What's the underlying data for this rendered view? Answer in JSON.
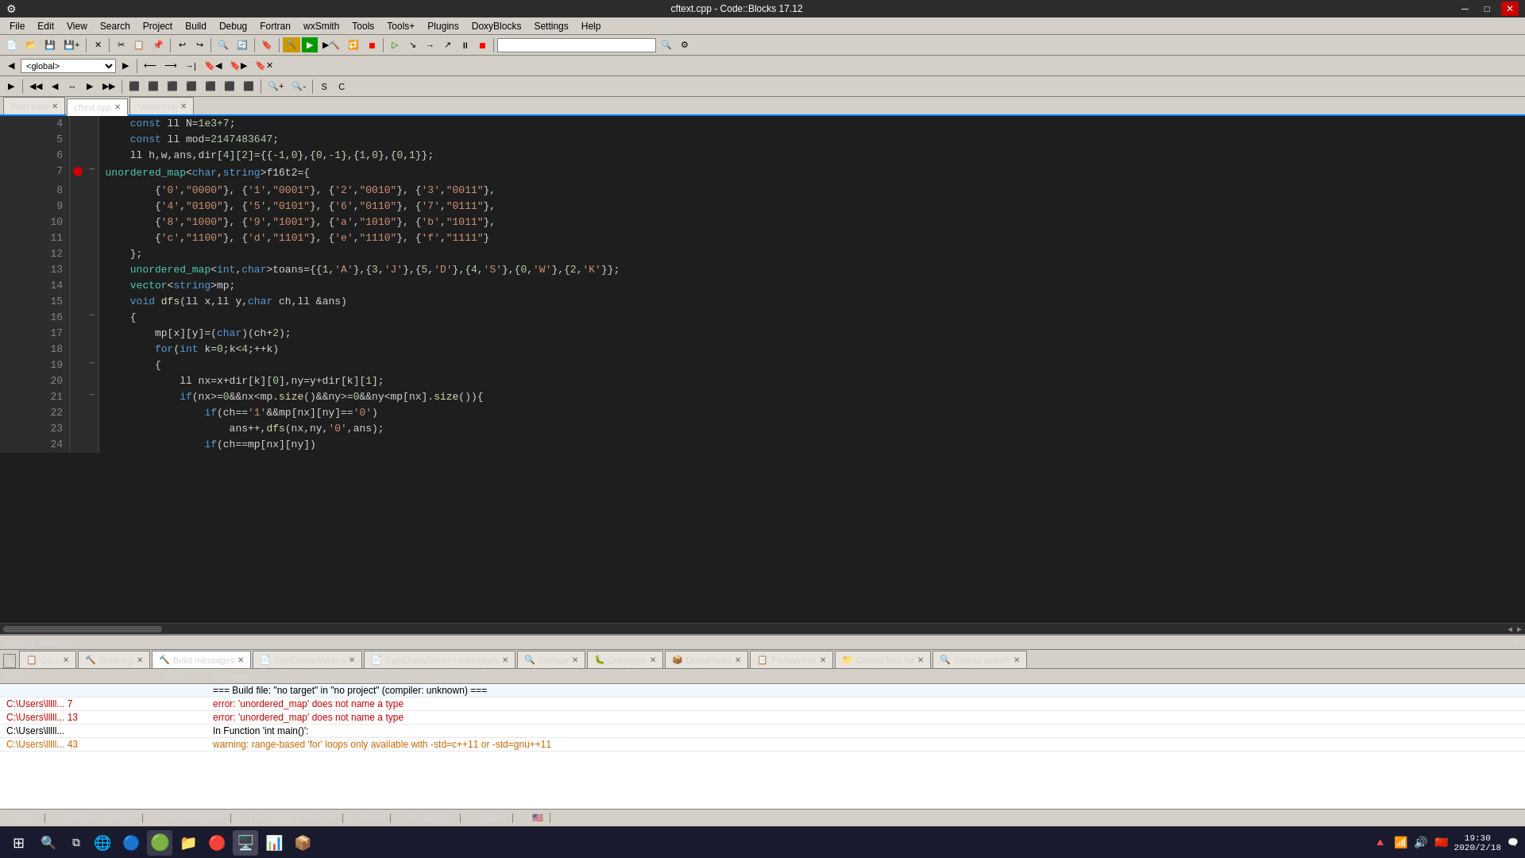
{
  "titlebar": {
    "title": "cftext.cpp - Code::Blocks 17.12",
    "min": "─",
    "max": "□",
    "close": "✕"
  },
  "menubar": {
    "items": [
      "File",
      "Edit",
      "View",
      "Search",
      "Project",
      "Build",
      "Debug",
      "Fortran",
      "wxSmith",
      "Tools",
      "Tools+",
      "Plugins",
      "DoxyBlocks",
      "Settings",
      "Help"
    ]
  },
  "global_scope": "<global>",
  "tabs": [
    {
      "label": "Start here",
      "active": false,
      "closeable": true
    },
    {
      "label": "cftext.cpp",
      "active": true,
      "closeable": true
    },
    {
      "label": "*swpu.cpp",
      "active": false,
      "closeable": true
    }
  ],
  "code_lines": [
    {
      "num": 4,
      "bp": "",
      "fold": "",
      "content_html": "    <span class='kw'>const</span> ll N=<span class='num'>1e3+7</span>;"
    },
    {
      "num": 5,
      "bp": "",
      "fold": "",
      "content_html": "    <span class='kw'>const</span> ll mod=<span class='num'>2147483647</span>;"
    },
    {
      "num": 6,
      "bp": "",
      "fold": "",
      "content_html": "    ll h,w,ans,dir[<span class='num'>4</span>][<span class='num'>2</span>]={{<span class='num'>-1</span>,<span class='num'>0</span>},{<span class='num'>0</span>,<span class='num'>-1</span>},{<span class='num'>1</span>,<span class='num'>0</span>},{<span class='num'>0</span>,<span class='num'>1</span>}};"
    },
    {
      "num": 7,
      "bp": "●",
      "fold": "□",
      "content_html": "<span class='cyan-text'>unordered_map</span>&lt;<span class='kw'>char</span>,<span class='kw'>string</span>&gt;f16t2={"
    },
    {
      "num": 8,
      "bp": "",
      "fold": "",
      "content_html": "        {<span class='str'>'0'</span>,<span class='str'>\"0000\"</span>}, {<span class='str'>'1'</span>,<span class='str'>\"0001\"</span>}, {<span class='str'>'2'</span>,<span class='str'>\"0010\"</span>}, {<span class='str'>'3'</span>,<span class='str'>\"0011\"</span>},"
    },
    {
      "num": 9,
      "bp": "",
      "fold": "",
      "content_html": "        {<span class='str'>'4'</span>,<span class='str'>\"0100\"</span>}, {<span class='str'>'5'</span>,<span class='str'>\"0101\"</span>}, {<span class='str'>'6'</span>,<span class='str'>\"0110\"</span>}, {<span class='str'>'7'</span>,<span class='str'>\"0111\"</span>},"
    },
    {
      "num": 10,
      "bp": "",
      "fold": "",
      "content_html": "        {<span class='str'>'8'</span>,<span class='str'>\"1000\"</span>}, {<span class='str'>'9'</span>,<span class='str'>\"1001\"</span>}, {<span class='str'>'a'</span>,<span class='str'>\"1010\"</span>}, {<span class='str'>'b'</span>,<span class='str'>\"1011\"</span>},"
    },
    {
      "num": 11,
      "bp": "",
      "fold": "",
      "content_html": "        {<span class='str'>'c'</span>,<span class='str'>\"1100\"</span>}, {<span class='str'>'d'</span>,<span class='str'>\"1101\"</span>}, {<span class='str'>'e'</span>,<span class='str'>\"1110\"</span>}, {<span class='str'>'f'</span>,<span class='str'>\"1111\"</span>}"
    },
    {
      "num": 12,
      "bp": "",
      "fold": "",
      "content_html": "    };"
    },
    {
      "num": 13,
      "bp": "",
      "fold": "",
      "content_html": "    <span class='cyan-text'>unordered_map</span>&lt;<span class='kw'>int</span>,<span class='kw'>char</span>&gt;toans={{<span class='num'>1</span>,<span class='str'>'A'</span>},{<span class='num'>3</span>,<span class='str'>'J'</span>},{<span class='num'>5</span>,<span class='str'>'D'</span>},{<span class='num'>4</span>,<span class='str'>'S'</span>},{<span class='num'>0</span>,<span class='str'>'W'</span>},{<span class='num'>2</span>,<span class='str'>'K'</span>}};"
    },
    {
      "num": 14,
      "bp": "",
      "fold": "",
      "content_html": "    <span class='cyan-text'>vector</span>&lt;<span class='kw'>string</span>&gt;mp;"
    },
    {
      "num": 15,
      "bp": "",
      "fold": "",
      "content_html": "    <span class='kw'>void</span> <span class='func'>dfs</span>(ll x,ll y,<span class='kw'>char</span> ch,ll &amp;ans)"
    },
    {
      "num": 16,
      "bp": "",
      "fold": "□",
      "content_html": "    {"
    },
    {
      "num": 17,
      "bp": "",
      "fold": "",
      "content_html": "        mp[x][y]=(<span class='kw'>char</span>)(ch+<span class='num'>2</span>);"
    },
    {
      "num": 18,
      "bp": "",
      "fold": "",
      "content_html": "        <span class='kw'>for</span>(<span class='kw'>int</span> k=<span class='num'>0</span>;k&lt;<span class='num'>4</span>;++k)"
    },
    {
      "num": 19,
      "bp": "",
      "fold": "□",
      "content_html": "        {"
    },
    {
      "num": 20,
      "bp": "",
      "fold": "",
      "content_html": "            ll nx=x+dir[k][<span class='num'>0</span>],ny=y+dir[k][<span class='num'>1</span>];"
    },
    {
      "num": 21,
      "bp": "",
      "fold": "□",
      "content_html": "            <span class='kw'>if</span>(nx&gt;=<span class='num'>0</span>&amp;&amp;nx&lt;mp.<span class='func'>size</span>()&amp;&amp;ny&gt;=<span class='num'>0</span>&amp;&amp;ny&lt;mp[nx].<span class='func'>size</span>()){"
    },
    {
      "num": 22,
      "bp": "",
      "fold": "",
      "content_html": "                <span class='kw'>if</span>(ch==<span class='str'>'1'</span>&amp;&amp;mp[nx][ny]==<span class='str'>'0'</span>)"
    },
    {
      "num": 23,
      "bp": "",
      "fold": "",
      "content_html": "                    ans++,<span class='func'>dfs</span>(nx,ny,<span class='str'>'0'</span>,ans);"
    },
    {
      "num": 24,
      "bp": "",
      "fold": "",
      "content_html": "                <span class='kw'>if</span>(ch==mp[nx][ny])"
    }
  ],
  "bottom_panel": {
    "title": "Logs & others",
    "tabs": [
      {
        "label": "Cccc",
        "active": false,
        "icon": "📋"
      },
      {
        "label": "Build log",
        "active": false,
        "icon": "🔨"
      },
      {
        "label": "Build messages",
        "active": true,
        "icon": "🔨"
      },
      {
        "label": "CppCheck/Vera++",
        "active": false,
        "icon": "📄"
      },
      {
        "label": "CppCheck/Vera++ messages",
        "active": false,
        "icon": "📄"
      },
      {
        "label": "Cscope",
        "active": false,
        "icon": "🔍"
      },
      {
        "label": "Debugger",
        "active": false,
        "icon": "🐛"
      },
      {
        "label": "DoxyBlocks",
        "active": false,
        "icon": "📦"
      },
      {
        "label": "Fortran info",
        "active": false,
        "icon": "📋"
      },
      {
        "label": "Closed files list",
        "active": false,
        "icon": "📁"
      },
      {
        "label": "Thread search",
        "active": false,
        "icon": "🔍"
      }
    ],
    "columns": [
      "File",
      "Line",
      "Message"
    ],
    "rows": [
      {
        "file": "",
        "line": "",
        "message": "=== Build file: \"no target\" in \"no project\" (compiler: unknown) ===",
        "type": "info"
      },
      {
        "file": "C:\\Users\\lllll... 7",
        "line": "",
        "message": "error: 'unordered_map' does not name a type",
        "type": "error"
      },
      {
        "file": "C:\\Users\\lllll... 13",
        "line": "",
        "message": "error: 'unordered_map' does not name a type",
        "type": "error"
      },
      {
        "file": "C:\\Users\\lllll...",
        "line": "",
        "message": "In Function 'int main()':",
        "type": "info"
      },
      {
        "file": "C:\\Users\\lllll... 43",
        "line": "",
        "message": "warning: range-based 'for' loops only available with -std=c++11 or -std=gnu++11",
        "type": "warning"
      }
    ]
  },
  "statusbar": {
    "lang": "C/C++",
    "eol": "Windows (CR+LF)",
    "encoding": "WINDOWS-936",
    "pos": "Line 7, Col 1, Pos 166",
    "mode": "Insert",
    "access": "Read/Write",
    "theme": "default",
    "flag": "🇺🇸"
  },
  "taskbar": {
    "start_icon": "⊞",
    "search_icon": "🔍",
    "task_view": "⧉",
    "apps": [
      "🌐",
      "🔵",
      "📁",
      "🔴",
      "📦",
      "🖥️",
      "📊"
    ],
    "time": "19:30",
    "date": "2020/2/18"
  }
}
